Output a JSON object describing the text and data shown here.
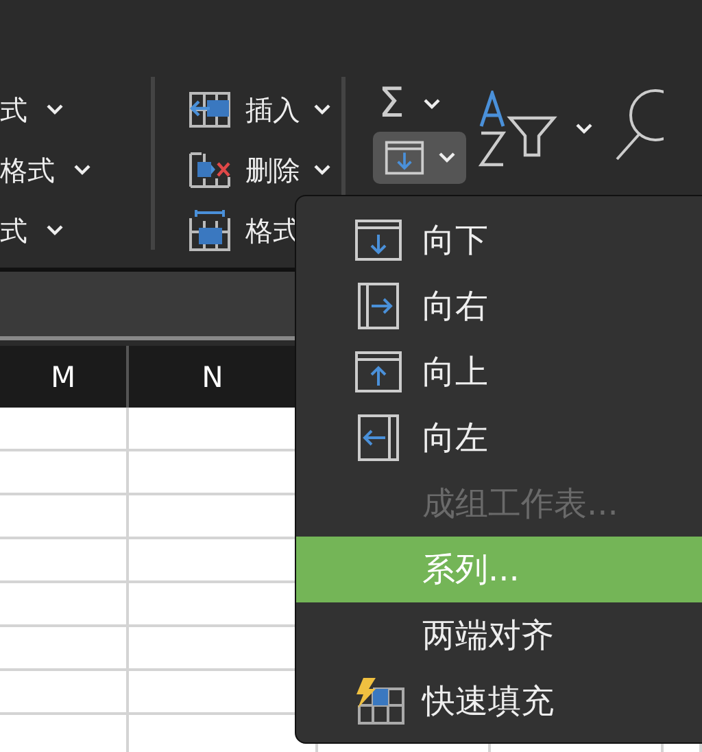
{
  "ribbon": {
    "styles_group": [
      {
        "label": "式"
      },
      {
        "label": "格式"
      },
      {
        "label": "式"
      }
    ],
    "cells_group": [
      {
        "label": "插入"
      },
      {
        "label": "删除"
      },
      {
        "label": "格式"
      }
    ],
    "editing_group": {
      "autosum_symbol": "Σ",
      "fill_selected": true
    }
  },
  "sheet": {
    "columns": [
      "M",
      "N"
    ]
  },
  "fill_menu": [
    {
      "label": "向下",
      "disabled": false,
      "selected": false
    },
    {
      "label": "向右",
      "disabled": false,
      "selected": false
    },
    {
      "label": "向上",
      "disabled": false,
      "selected": false
    },
    {
      "label": "向左",
      "disabled": false,
      "selected": false
    },
    {
      "label": "成组工作表...",
      "disabled": true,
      "selected": false
    },
    {
      "label": "系列...",
      "disabled": false,
      "selected": true
    },
    {
      "label": "两端对齐",
      "disabled": false,
      "selected": false
    },
    {
      "label": "快速填充",
      "disabled": false,
      "selected": false
    }
  ]
}
